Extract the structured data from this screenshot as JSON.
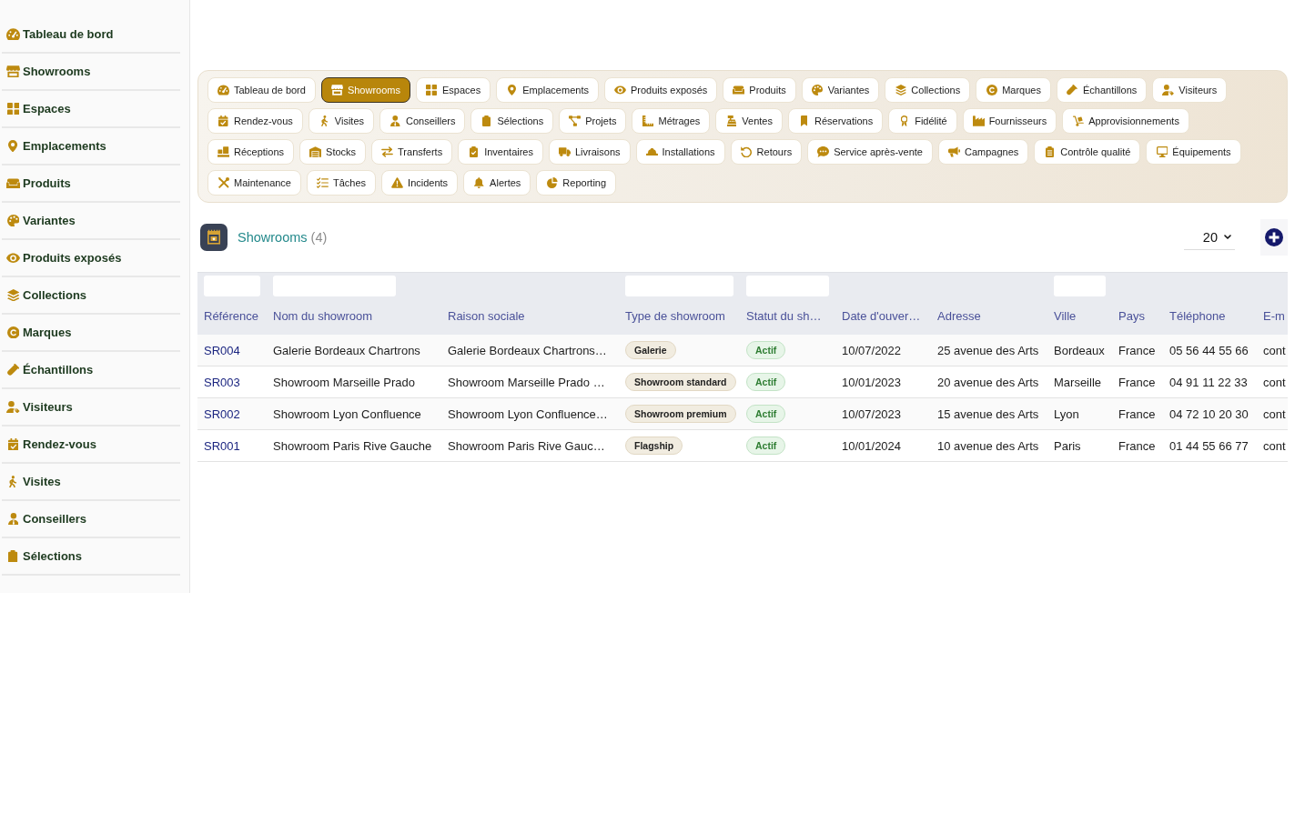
{
  "sidebar": {
    "items": [
      "Tableau de bord",
      "Showrooms",
      "Espaces",
      "Emplacements",
      "Produits",
      "Variantes",
      "Produits exposés",
      "Collections",
      "Marques",
      "Échantillons",
      "Visiteurs",
      "Rendez-vous",
      "Visites",
      "Conseillers",
      "Sélections"
    ]
  },
  "module_tabs": [
    {
      "label": "Tableau de bord",
      "selected": false
    },
    {
      "label": "Showrooms",
      "selected": true
    },
    {
      "label": "Espaces",
      "selected": false
    },
    {
      "label": "Emplacements",
      "selected": false
    },
    {
      "label": "Produits exposés",
      "selected": false
    },
    {
      "label": "Produits",
      "selected": false
    },
    {
      "label": "Variantes",
      "selected": false
    },
    {
      "label": "Collections",
      "selected": false
    },
    {
      "label": "Marques",
      "selected": false
    },
    {
      "label": "Échantillons",
      "selected": false
    },
    {
      "label": "Visiteurs",
      "selected": false
    },
    {
      "label": "Rendez-vous",
      "selected": false
    },
    {
      "label": "Visites",
      "selected": false
    },
    {
      "label": "Conseillers",
      "selected": false
    },
    {
      "label": "Sélections",
      "selected": false
    },
    {
      "label": "Projets",
      "selected": false
    },
    {
      "label": "Métrages",
      "selected": false
    },
    {
      "label": "Ventes",
      "selected": false
    },
    {
      "label": "Réservations",
      "selected": false
    },
    {
      "label": "Fidélité",
      "selected": false
    },
    {
      "label": "Fournisseurs",
      "selected": false
    },
    {
      "label": "Approvisionnements",
      "selected": false
    },
    {
      "label": "Réceptions",
      "selected": false
    },
    {
      "label": "Stocks",
      "selected": false
    },
    {
      "label": "Transferts",
      "selected": false
    },
    {
      "label": "Inventaires",
      "selected": false
    },
    {
      "label": "Livraisons",
      "selected": false
    },
    {
      "label": "Installations",
      "selected": false
    },
    {
      "label": "Retours",
      "selected": false
    },
    {
      "label": "Service après-vente",
      "selected": false
    },
    {
      "label": "Campagnes",
      "selected": false
    },
    {
      "label": "Contrôle qualité",
      "selected": false
    },
    {
      "label": "Équipements",
      "selected": false
    },
    {
      "label": "Maintenance",
      "selected": false
    },
    {
      "label": "Tâches",
      "selected": false
    },
    {
      "label": "Incidents",
      "selected": false
    },
    {
      "label": "Alertes",
      "selected": false
    },
    {
      "label": "Reporting",
      "selected": false
    }
  ],
  "list_header": {
    "title": "Showrooms",
    "count": "(4)",
    "page_size": "20"
  },
  "table": {
    "columns": [
      {
        "label": "Référence",
        "kind": "link",
        "filter": true
      },
      {
        "label": "Nom du showroom",
        "kind": "text",
        "filter": true
      },
      {
        "label": "Raison sociale",
        "kind": "text",
        "filter": false
      },
      {
        "label": "Type de showroom",
        "kind": "tag",
        "filter": true
      },
      {
        "label": "Statut du sh…",
        "kind": "status",
        "filter": true
      },
      {
        "label": "Date d'ouver…",
        "kind": "text",
        "filter": false
      },
      {
        "label": "Adresse",
        "kind": "text",
        "filter": false
      },
      {
        "label": "Ville",
        "kind": "text",
        "filter": true
      },
      {
        "label": "Pays",
        "kind": "text",
        "filter": false
      },
      {
        "label": "Téléphone",
        "kind": "text",
        "filter": false
      },
      {
        "label": "E-m",
        "kind": "text",
        "filter": false
      }
    ],
    "rows": [
      [
        "SR004",
        "Galerie Bordeaux Chartrons",
        "Galerie Bordeaux Chartrons…",
        "Galerie",
        "Actif",
        "10/07/2022",
        "25 avenue des Arts",
        "Bordeaux",
        "France",
        "05 56 44 55 66",
        "cont"
      ],
      [
        "SR003",
        "Showroom Marseille Prado",
        "Showroom Marseille Prado …",
        "Showroom standard",
        "Actif",
        "10/01/2023",
        "20 avenue des Arts",
        "Marseille",
        "France",
        "04 91 11 22 33",
        "cont"
      ],
      [
        "SR002",
        "Showroom Lyon Confluence",
        "Showroom Lyon Confluence…",
        "Showroom premium",
        "Actif",
        "10/07/2023",
        "15 avenue des Arts",
        "Lyon",
        "France",
        "04 72 10 20 30",
        "cont"
      ],
      [
        "SR001",
        "Showroom Paris Rive Gauche",
        "Showroom Paris Rive Gauc…",
        "Flagship",
        "Actif",
        "10/01/2024",
        "10 avenue des Arts",
        "Paris",
        "France",
        "01 44 55 66 77",
        "cont"
      ]
    ]
  }
}
